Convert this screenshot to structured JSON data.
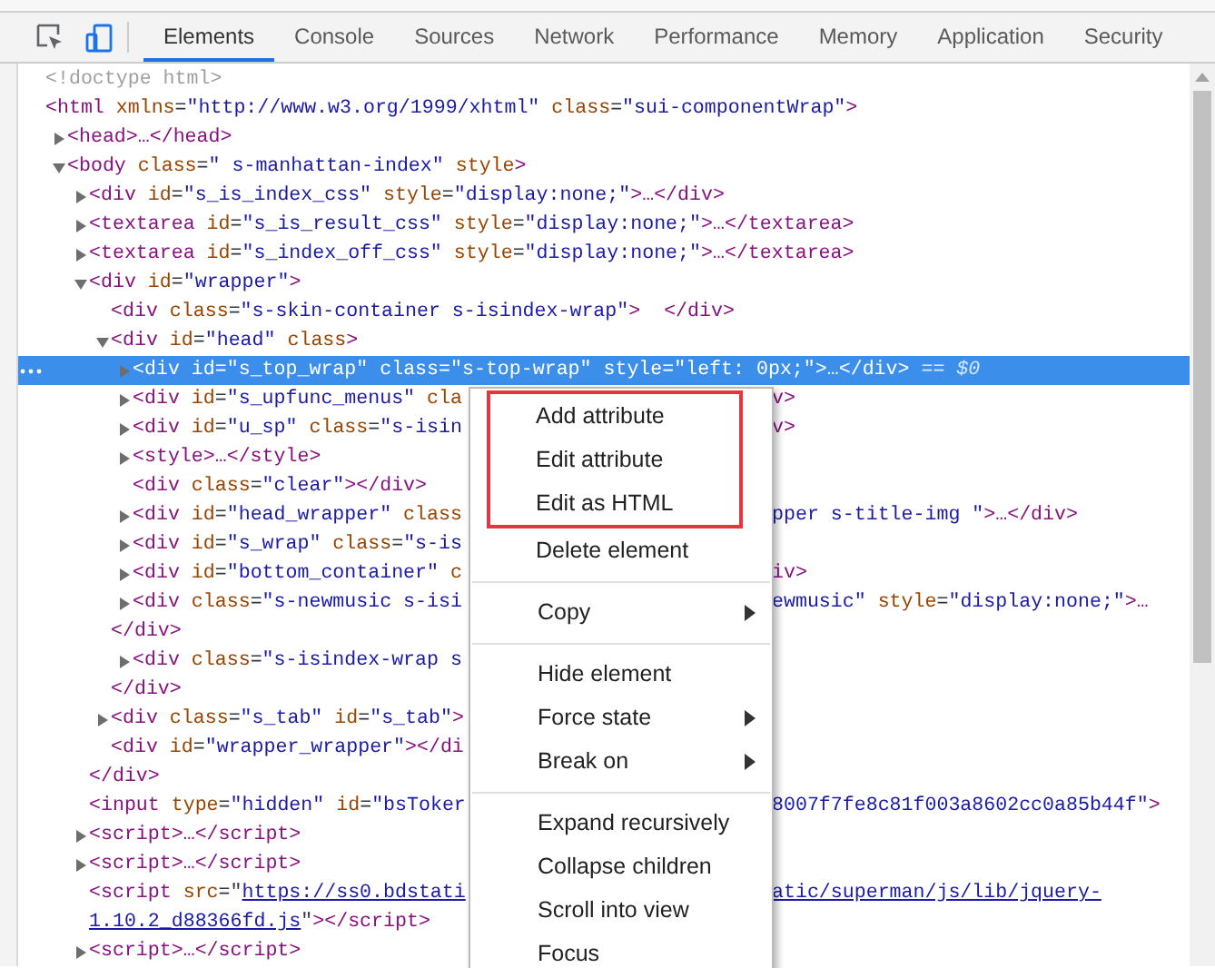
{
  "toolbar": {
    "device_toolbar": {
      "on": true
    }
  },
  "tabs": [
    {
      "label": "Elements",
      "selected": true
    },
    {
      "label": "Console",
      "selected": false
    },
    {
      "label": "Sources",
      "selected": false
    },
    {
      "label": "Network",
      "selected": false
    },
    {
      "label": "Performance",
      "selected": false
    },
    {
      "label": "Memory",
      "selected": false
    },
    {
      "label": "Application",
      "selected": false
    },
    {
      "label": "Security",
      "selected": false
    }
  ],
  "dom_tree": [
    {
      "kind": "element",
      "selected": false,
      "tokens": [
        {
          "kind": "comment",
          "text": "<!doctype html>"
        }
      ]
    },
    {
      "kind": "element",
      "selected": false,
      "tokens": [
        {
          "kind": "tag",
          "text": "<html"
        },
        {
          "kind": "attr",
          "text": " xmlns"
        },
        {
          "kind": "punct",
          "text": "="
        },
        {
          "kind": "value",
          "text": "\"http://www.w3.org/1999/xhtml\""
        },
        {
          "kind": "attr",
          "text": " class"
        },
        {
          "kind": "punct",
          "text": "="
        },
        {
          "kind": "value",
          "text": "\"sui-componentWrap\""
        },
        {
          "kind": "tag",
          "text": ">"
        }
      ],
      "children": [
        {
          "kind": "element",
          "selected": false,
          "expanded": false,
          "tokens": [
            {
              "kind": "tag",
              "text": "<head>…</head>"
            }
          ]
        },
        {
          "kind": "element",
          "selected": false,
          "expanded": true,
          "tokens": [
            {
              "kind": "tag",
              "text": "<body"
            },
            {
              "kind": "attr",
              "text": " class"
            },
            {
              "kind": "punct",
              "text": "="
            },
            {
              "kind": "value",
              "text": "\" s-manhattan-index\""
            },
            {
              "kind": "attr",
              "text": " style"
            },
            {
              "kind": "tag",
              "text": ">"
            }
          ],
          "children": [
            {
              "kind": "element",
              "selected": false,
              "expanded": false,
              "tokens": [
                {
                  "kind": "tag",
                  "text": "<div"
                },
                {
                  "kind": "attr",
                  "text": " id"
                },
                {
                  "kind": "punct",
                  "text": "="
                },
                {
                  "kind": "value",
                  "text": "\"s_is_index_css\""
                },
                {
                  "kind": "attr",
                  "text": " style"
                },
                {
                  "kind": "punct",
                  "text": "="
                },
                {
                  "kind": "value",
                  "text": "\"display:none;\""
                },
                {
                  "kind": "tag",
                  "text": ">…</div>"
                }
              ]
            },
            {
              "kind": "element",
              "selected": false,
              "expanded": false,
              "tokens": [
                {
                  "kind": "tag",
                  "text": "<textarea"
                },
                {
                  "kind": "attr",
                  "text": " id"
                },
                {
                  "kind": "punct",
                  "text": "="
                },
                {
                  "kind": "value",
                  "text": "\"s_is_result_css\""
                },
                {
                  "kind": "attr",
                  "text": " style"
                },
                {
                  "kind": "punct",
                  "text": "="
                },
                {
                  "kind": "value",
                  "text": "\"display:none;\""
                },
                {
                  "kind": "tag",
                  "text": ">…</textarea>"
                }
              ]
            },
            {
              "kind": "element",
              "selected": false,
              "expanded": false,
              "tokens": [
                {
                  "kind": "tag",
                  "text": "<textarea"
                },
                {
                  "kind": "attr",
                  "text": " id"
                },
                {
                  "kind": "punct",
                  "text": "="
                },
                {
                  "kind": "value",
                  "text": "\"s_index_off_css\""
                },
                {
                  "kind": "attr",
                  "text": " style"
                },
                {
                  "kind": "punct",
                  "text": "="
                },
                {
                  "kind": "value",
                  "text": "\"display:none;\""
                },
                {
                  "kind": "tag",
                  "text": ">…</textarea>"
                }
              ]
            },
            {
              "kind": "element",
              "selected": false,
              "expanded": true,
              "tokens": [
                {
                  "kind": "tag",
                  "text": "<div"
                },
                {
                  "kind": "attr",
                  "text": " id"
                },
                {
                  "kind": "punct",
                  "text": "="
                },
                {
                  "kind": "value",
                  "text": "\"wrapper\""
                },
                {
                  "kind": "tag",
                  "text": ">"
                }
              ],
              "children": [
                {
                  "kind": "element",
                  "selected": false,
                  "tokens": [
                    {
                      "kind": "tag",
                      "text": "<div"
                    },
                    {
                      "kind": "attr",
                      "text": " class"
                    },
                    {
                      "kind": "punct",
                      "text": "="
                    },
                    {
                      "kind": "value",
                      "text": "\"s-skin-container s-isindex-wrap\""
                    },
                    {
                      "kind": "tag",
                      "text": ">  </div>"
                    }
                  ]
                },
                {
                  "kind": "element",
                  "selected": false,
                  "expanded": true,
                  "tokens": [
                    {
                      "kind": "tag",
                      "text": "<div"
                    },
                    {
                      "kind": "attr",
                      "text": " id"
                    },
                    {
                      "kind": "punct",
                      "text": "="
                    },
                    {
                      "kind": "value",
                      "text": "\"head\""
                    },
                    {
                      "kind": "attr",
                      "text": " class"
                    },
                    {
                      "kind": "tag",
                      "text": ">"
                    }
                  ],
                  "children": [
                    {
                      "kind": "element",
                      "selected": true,
                      "expanded": false,
                      "tokens": [
                        {
                          "kind": "tag",
                          "text": "<div"
                        },
                        {
                          "kind": "attr",
                          "text": " id"
                        },
                        {
                          "kind": "punct",
                          "text": "="
                        },
                        {
                          "kind": "value",
                          "text": "\"s_top_wrap\""
                        },
                        {
                          "kind": "attr",
                          "text": " class"
                        },
                        {
                          "kind": "punct",
                          "text": "="
                        },
                        {
                          "kind": "value",
                          "text": "\"s-top-wrap\""
                        },
                        {
                          "kind": "attr",
                          "text": " style"
                        },
                        {
                          "kind": "punct",
                          "text": "="
                        },
                        {
                          "kind": "value",
                          "text": "\"left: 0px;\""
                        },
                        {
                          "kind": "tag",
                          "text": ">…</div>"
                        },
                        {
                          "kind": "marker",
                          "text": " == $0"
                        }
                      ]
                    },
                    {
                      "kind": "element",
                      "selected": false,
                      "expanded": false,
                      "tokens": [
                        {
                          "kind": "tag",
                          "text": "<div"
                        },
                        {
                          "kind": "attr",
                          "text": " id"
                        },
                        {
                          "kind": "punct",
                          "text": "="
                        },
                        {
                          "kind": "value",
                          "text": "\"s_upfunc_menus\""
                        },
                        {
                          "kind": "attr",
                          "text": " cla"
                        }
                      ],
                      "after": [
                        {
                          "kind": "tag",
                          "text": "v>"
                        }
                      ]
                    },
                    {
                      "kind": "element",
                      "selected": false,
                      "expanded": false,
                      "tokens": [
                        {
                          "kind": "tag",
                          "text": "<div"
                        },
                        {
                          "kind": "attr",
                          "text": " id"
                        },
                        {
                          "kind": "punct",
                          "text": "="
                        },
                        {
                          "kind": "value",
                          "text": "\"u_sp\""
                        },
                        {
                          "kind": "attr",
                          "text": " class"
                        },
                        {
                          "kind": "punct",
                          "text": "="
                        },
                        {
                          "kind": "value",
                          "text": "\"s-isin"
                        }
                      ],
                      "after": [
                        {
                          "kind": "tag",
                          "text": "v>"
                        }
                      ]
                    },
                    {
                      "kind": "element",
                      "selected": false,
                      "expanded": false,
                      "tokens": [
                        {
                          "kind": "tag",
                          "text": "<style>…</style>"
                        }
                      ]
                    },
                    {
                      "kind": "element",
                      "selected": false,
                      "tokens": [
                        {
                          "kind": "tag",
                          "text": "<div"
                        },
                        {
                          "kind": "attr",
                          "text": " class"
                        },
                        {
                          "kind": "punct",
                          "text": "="
                        },
                        {
                          "kind": "value",
                          "text": "\"clear\""
                        },
                        {
                          "kind": "tag",
                          "text": "></div>"
                        }
                      ]
                    },
                    {
                      "kind": "element",
                      "selected": false,
                      "expanded": false,
                      "tokens": [
                        {
                          "kind": "tag",
                          "text": "<div"
                        },
                        {
                          "kind": "attr",
                          "text": " id"
                        },
                        {
                          "kind": "punct",
                          "text": "="
                        },
                        {
                          "kind": "value",
                          "text": "\"head_wrapper\""
                        },
                        {
                          "kind": "attr",
                          "text": " class"
                        }
                      ],
                      "after": [
                        {
                          "kind": "value",
                          "text": "pper s-title-img \""
                        },
                        {
                          "kind": "tag",
                          "text": ">…</div>"
                        }
                      ]
                    },
                    {
                      "kind": "element",
                      "selected": false,
                      "expanded": false,
                      "tokens": [
                        {
                          "kind": "tag",
                          "text": "<div"
                        },
                        {
                          "kind": "attr",
                          "text": " id"
                        },
                        {
                          "kind": "punct",
                          "text": "="
                        },
                        {
                          "kind": "value",
                          "text": "\"s_wrap\""
                        },
                        {
                          "kind": "attr",
                          "text": " class"
                        },
                        {
                          "kind": "punct",
                          "text": "="
                        },
                        {
                          "kind": "value",
                          "text": "\"s-is"
                        }
                      ]
                    },
                    {
                      "kind": "element",
                      "selected": false,
                      "expanded": false,
                      "tokens": [
                        {
                          "kind": "tag",
                          "text": "<div"
                        },
                        {
                          "kind": "attr",
                          "text": " id"
                        },
                        {
                          "kind": "punct",
                          "text": "="
                        },
                        {
                          "kind": "value",
                          "text": "\"bottom_container\""
                        },
                        {
                          "kind": "attr",
                          "text": " c"
                        }
                      ],
                      "after": [
                        {
                          "kind": "tag",
                          "text": "iv>"
                        }
                      ]
                    },
                    {
                      "kind": "element",
                      "selected": false,
                      "expanded": false,
                      "tokens": [
                        {
                          "kind": "tag",
                          "text": "<div"
                        },
                        {
                          "kind": "attr",
                          "text": " class"
                        },
                        {
                          "kind": "punct",
                          "text": "="
                        },
                        {
                          "kind": "value",
                          "text": "\"s-newmusic s-isi"
                        }
                      ],
                      "after": [
                        {
                          "kind": "value",
                          "text": "ewmusic\""
                        },
                        {
                          "kind": "attr",
                          "text": " style"
                        },
                        {
                          "kind": "punct",
                          "text": "="
                        },
                        {
                          "kind": "value",
                          "text": "\"display:none;\""
                        },
                        {
                          "kind": "tag",
                          "text": ">…"
                        }
                      ]
                    },
                    {
                      "kind": "closing",
                      "selected": false,
                      "tokens": [
                        {
                          "kind": "tag",
                          "text": "</div>"
                        }
                      ]
                    },
                    {
                      "kind": "element",
                      "selected": false,
                      "expanded": false,
                      "tokens": [
                        {
                          "kind": "tag",
                          "text": "<div"
                        },
                        {
                          "kind": "attr",
                          "text": " class"
                        },
                        {
                          "kind": "punct",
                          "text": "="
                        },
                        {
                          "kind": "value",
                          "text": "\"s-isindex-wrap s"
                        }
                      ]
                    },
                    {
                      "kind": "closing",
                      "selected": false,
                      "tokens": [
                        {
                          "kind": "tag",
                          "text": "</div>"
                        }
                      ]
                    }
                  ]
                },
                {
                  "kind": "element",
                  "selected": false,
                  "expanded": false,
                  "tokens": [
                    {
                      "kind": "tag",
                      "text": "<div"
                    },
                    {
                      "kind": "attr",
                      "text": " class"
                    },
                    {
                      "kind": "punct",
                      "text": "="
                    },
                    {
                      "kind": "value",
                      "text": "\"s_tab\""
                    },
                    {
                      "kind": "attr",
                      "text": " id"
                    },
                    {
                      "kind": "punct",
                      "text": "="
                    },
                    {
                      "kind": "value",
                      "text": "\"s_tab\""
                    },
                    {
                      "kind": "tag",
                      "text": ">"
                    }
                  ]
                },
                {
                  "kind": "element",
                  "selected": false,
                  "tokens": [
                    {
                      "kind": "tag",
                      "text": "<div"
                    },
                    {
                      "kind": "attr",
                      "text": " id"
                    },
                    {
                      "kind": "punct",
                      "text": "="
                    },
                    {
                      "kind": "value",
                      "text": "\"wrapper_wrapper\""
                    },
                    {
                      "kind": "tag",
                      "text": "></di"
                    }
                  ]
                },
                {
                  "kind": "closing",
                  "selected": false,
                  "tokens": [
                    {
                      "kind": "tag",
                      "text": "</div>"
                    }
                  ]
                }
              ]
            },
            {
              "kind": "element",
              "selected": false,
              "tokens": [
                {
                  "kind": "tag",
                  "text": "<input"
                },
                {
                  "kind": "attr",
                  "text": " type"
                },
                {
                  "kind": "punct",
                  "text": "="
                },
                {
                  "kind": "value",
                  "text": "\"hidden\""
                },
                {
                  "kind": "attr",
                  "text": " id"
                },
                {
                  "kind": "punct",
                  "text": "="
                },
                {
                  "kind": "value",
                  "text": "\"bsToker"
                }
              ],
              "after": [
                {
                  "kind": "value",
                  "text": "8007f7fe8c81f003a8602cc0a85b44f\""
                },
                {
                  "kind": "tag",
                  "text": ">"
                }
              ]
            },
            {
              "kind": "element",
              "selected": false,
              "expanded": false,
              "tokens": [
                {
                  "kind": "tag",
                  "text": "<script>…</script>"
                }
              ]
            },
            {
              "kind": "element",
              "selected": false,
              "expanded": false,
              "tokens": [
                {
                  "kind": "tag",
                  "text": "<script>…</script>"
                }
              ]
            },
            {
              "kind": "element",
              "selected": false,
              "tokens": [
                {
                  "kind": "tag",
                  "text": "<script"
                },
                {
                  "kind": "attr",
                  "text": " src"
                },
                {
                  "kind": "punct",
                  "text": "=\""
                },
                {
                  "kind": "link",
                  "text": "https://ss0.bdstati"
                }
              ],
              "after": [
                {
                  "kind": "link",
                  "text": "atic/superman/js/lib/jquery-"
                }
              ]
            },
            {
              "kind": "element",
              "selected": false,
              "tokens": [
                {
                  "kind": "link",
                  "text": "1.10.2_d88366fd.js"
                },
                {
                  "kind": "punct",
                  "text": "\""
                },
                {
                  "kind": "tag",
                  "text": "></script>"
                }
              ]
            },
            {
              "kind": "element",
              "selected": false,
              "expanded": false,
              "tokens": [
                {
                  "kind": "tag",
                  "text": "<script>…</script>"
                }
              ]
            }
          ]
        }
      ]
    }
  ],
  "context_menu": {
    "groups": [
      [
        {
          "label": "Add attribute",
          "submenu": false,
          "outlined": true
        },
        {
          "label": "Edit attribute",
          "submenu": false,
          "outlined": true
        },
        {
          "label": "Edit as HTML",
          "submenu": false,
          "outlined": true
        },
        {
          "label": "Delete element",
          "submenu": false,
          "outlined": false
        }
      ],
      [
        {
          "label": "Copy",
          "submenu": true,
          "outlined": false
        }
      ],
      [
        {
          "label": "Hide element",
          "submenu": false,
          "outlined": false
        },
        {
          "label": "Force state",
          "submenu": true,
          "outlined": false
        },
        {
          "label": "Break on",
          "submenu": true,
          "outlined": false
        }
      ],
      [
        {
          "label": "Expand recursively",
          "submenu": false,
          "outlined": false
        },
        {
          "label": "Collapse children",
          "submenu": false,
          "outlined": false
        },
        {
          "label": "Scroll into view",
          "submenu": false,
          "outlined": false
        },
        {
          "label": "Focus",
          "submenu": false,
          "outlined": false
        }
      ]
    ]
  }
}
